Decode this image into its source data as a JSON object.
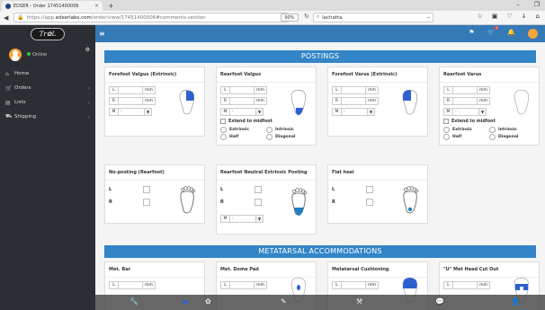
{
  "browser": {
    "tab_title": "EDSER - Order 17451400006",
    "tab_close": "×",
    "new_tab": "+",
    "url_prefix": "https://app.",
    "url_domain": "edserlabs.com",
    "url_path": "/order/view/17451400006#comments-section",
    "zoom": "90%",
    "search_value": "lachatta",
    "win_min": "–",
    "win_max": "❐"
  },
  "sidebar": {
    "logo_text": "Tr✿L",
    "status": "Online",
    "items": [
      {
        "label": "Home",
        "icon": "home-icon"
      },
      {
        "label": "Orders",
        "icon": "cart-icon"
      },
      {
        "label": "Lists",
        "icon": "list-icon"
      },
      {
        "label": "Shipping",
        "icon": "truck-icon"
      }
    ]
  },
  "appbar": {
    "menu_glyph": "≡",
    "notifications_count": "1"
  },
  "postings": {
    "header": "POSTINGS",
    "unit": "mm",
    "select_value": "-",
    "labels": {
      "L": "L",
      "R": "R",
      "M": "M"
    },
    "extend_label": "Extend to midfoot",
    "radio_labels": [
      "Extrinsic",
      "Intrinsic",
      "Half",
      "Diagonal"
    ],
    "cards": [
      {
        "title": "Forefoot Valgus (Extrinsic)"
      },
      {
        "title": "Rearfoot Valgus"
      },
      {
        "title": "Forefoot Varus (Extrinsic)"
      },
      {
        "title": "Rearfoot Varus"
      },
      {
        "title": "No-posting (Rearfoot)"
      },
      {
        "title": "Rearfoot Neutral Extrinsic Posting"
      },
      {
        "title": "Flat heel"
      }
    ]
  },
  "metatarsal": {
    "header": "METATARSAL ACCOMMODATIONS",
    "cards": [
      {
        "title": "Met. Bar"
      },
      {
        "title": "Met. Dome Pad"
      },
      {
        "title": "Metatarsal Cushioning"
      },
      {
        "title": "\"U\" Met Head Cut Out"
      }
    ]
  },
  "colors": {
    "primary": "#337ab7",
    "section": "#3385c8",
    "sidebar": "#2b2f33",
    "highlight": "#2d5fd3",
    "highlight_light": "#4a90e2"
  }
}
